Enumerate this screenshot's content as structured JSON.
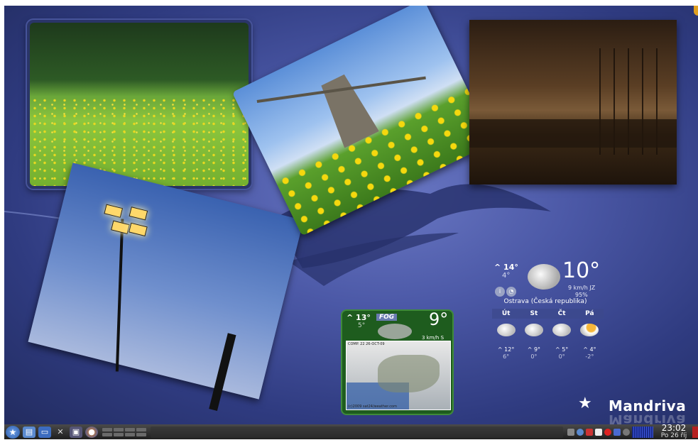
{
  "weather_main": {
    "high": "^ 14°",
    "low": "4°",
    "current_temp": "10°",
    "wind": "9 km/h JZ",
    "humidity": "95%",
    "location": "Ostrava (Česká republika)",
    "forecast": [
      {
        "day": "Út",
        "icon": "rain-cloud-icon",
        "high": "^ 12°",
        "low": "6°"
      },
      {
        "day": "St",
        "icon": "cloud-icon",
        "high": "^ 9°",
        "low": "0°"
      },
      {
        "day": "Čt",
        "icon": "cloud-icon",
        "high": "^ 5°",
        "low": "0°"
      },
      {
        "day": "Pá",
        "icon": "sun-cloud-icon",
        "high": "^ 4°",
        "low": "-2°"
      }
    ]
  },
  "weather_widget2": {
    "high": "^ 13°",
    "low": "5°",
    "condition": "FOG",
    "current_temp": "9°",
    "wind": "3 km/h S",
    "map_caption": "COMP. 22 26-OCT-09",
    "map_credit": "(c)2009 sat24/weather.com"
  },
  "logo": {
    "text": "Mandriva"
  },
  "panel": {
    "launchers": [
      "start-menu-icon",
      "file-manager-icon",
      "desktop-icon",
      "system-tools-icon",
      "control-center-icon",
      "firefox-icon"
    ],
    "clock_time": "23:02",
    "clock_date": "Po 26 říj"
  },
  "colors": {
    "desktop_bg": "#3a4690",
    "panel_bg": "#2a2a2a",
    "widget2_bg": "#1e5c1e"
  }
}
